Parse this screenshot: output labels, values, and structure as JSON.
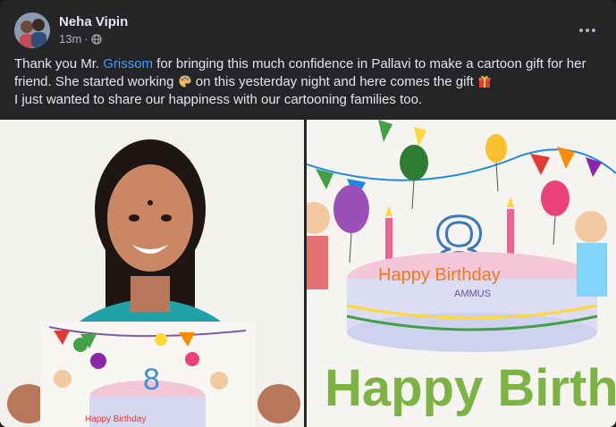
{
  "post": {
    "author": "Neha Vipin",
    "time": "13m",
    "separator": "·",
    "text": {
      "part1": "Thank you Mr. ",
      "mention": "Grissom",
      "part2": " for bringing this much confidence in Pallavi to make a cartoon gift for her friend. She started working ",
      "part3": " on this yesterday night and here comes the gift ",
      "line2": "I just wanted to share our happiness with our cartooning families too."
    },
    "icons": [
      "palette-emoji",
      "gift-emoji",
      "globe-icon",
      "more-options-icon"
    ]
  },
  "drawing": {
    "number": "8",
    "cake_text_1": "Happy Birthday",
    "cake_name": "AMMUS",
    "banner_text": "Happy Birthday"
  },
  "colors": {
    "background": "#242526",
    "text": "#e4e6eb",
    "secondary_text": "#b0b3b8",
    "mention": "#4599ff"
  }
}
